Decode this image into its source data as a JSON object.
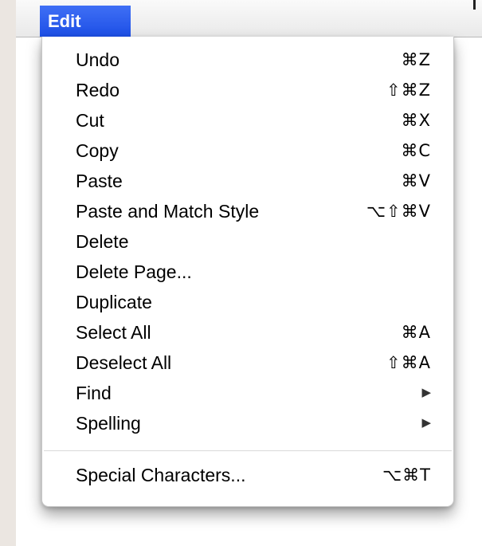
{
  "menubar": {
    "active_menu": "Edit"
  },
  "menu": {
    "items": [
      {
        "label": "Undo",
        "shortcut": "⌘Z"
      },
      {
        "label": "Redo",
        "shortcut": "⇧⌘Z"
      },
      {
        "label": "Cut",
        "shortcut": "⌘X"
      },
      {
        "label": "Copy",
        "shortcut": "⌘C"
      },
      {
        "label": "Paste",
        "shortcut": "⌘V"
      },
      {
        "label": "Paste and Match Style",
        "shortcut": "⌥⇧⌘V"
      },
      {
        "label": "Delete",
        "shortcut": ""
      },
      {
        "label": "Delete Page...",
        "shortcut": ""
      },
      {
        "label": "Duplicate",
        "shortcut": ""
      },
      {
        "label": "Select All",
        "shortcut": "⌘A"
      },
      {
        "label": "Deselect All",
        "shortcut": "⇧⌘A"
      },
      {
        "label": "Find",
        "submenu_icon": "submenu-arrow-icon"
      },
      {
        "label": "Spelling",
        "submenu_icon": "submenu-arrow-icon"
      }
    ],
    "footer_items": [
      {
        "label": "Special Characters...",
        "shortcut": "⌥⌘T"
      }
    ]
  },
  "colors": {
    "menu_title_highlight": "#1d4fe6",
    "menu_background": "#ffffff",
    "outer_background": "#ebe6e1"
  }
}
